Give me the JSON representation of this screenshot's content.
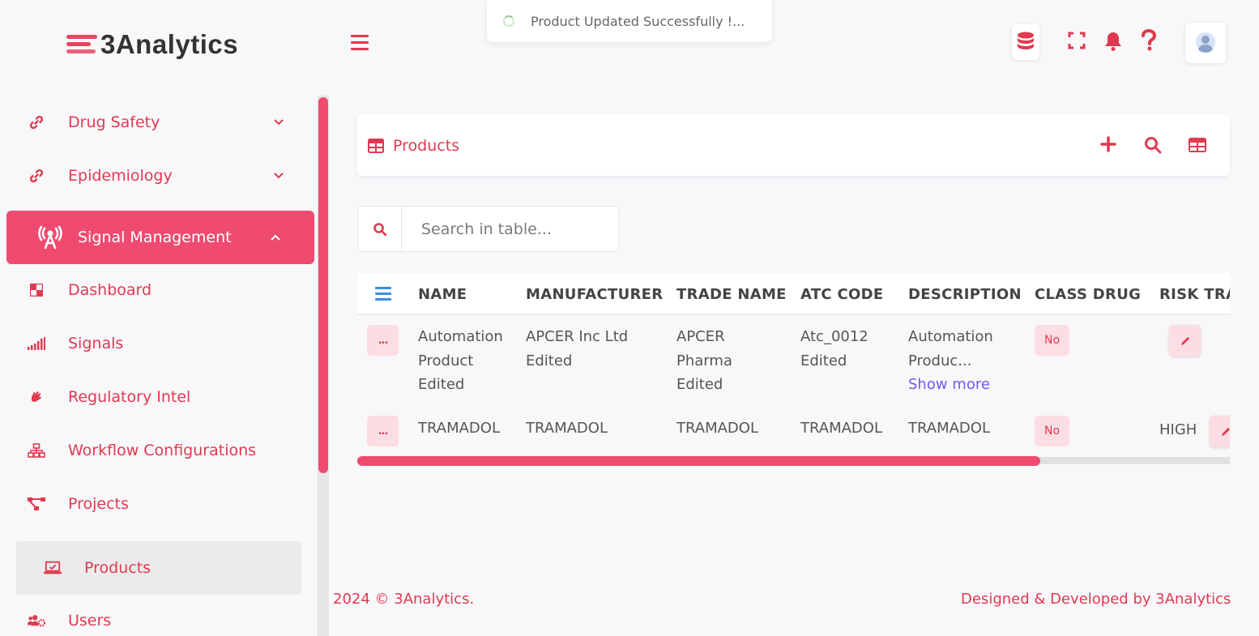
{
  "brand": {
    "name": "3Analytics",
    "accent": "#ef4b70",
    "primary_text": "#e03a4f"
  },
  "toast": {
    "message": "Product Updated Successfully !..."
  },
  "topbar": {
    "icons": [
      "database-icon",
      "fullscreen-icon",
      "bell-icon",
      "help-icon",
      "user-avatar-icon"
    ]
  },
  "sidebar": {
    "items": [
      {
        "label": "Drug Safety",
        "icon": "link-icon",
        "expandable": true
      },
      {
        "label": "Epidemiology",
        "icon": "link-icon",
        "expandable": true
      },
      {
        "label": "Signal Management",
        "icon": "antenna-icon",
        "expanded": true
      },
      {
        "label": "Dashboard",
        "icon": "dashboard-icon"
      },
      {
        "label": "Signals",
        "icon": "signal-bars-icon"
      },
      {
        "label": "Regulatory Intel",
        "icon": "hand-icon"
      },
      {
        "label": "Workflow Configurations",
        "icon": "sitemap-icon"
      },
      {
        "label": "Projects",
        "icon": "project-diagram-icon"
      },
      {
        "label": "Products",
        "icon": "laptop-icon",
        "selected": true
      },
      {
        "label": "Users",
        "icon": "users-cog-icon"
      }
    ]
  },
  "card": {
    "title": "Products"
  },
  "search": {
    "placeholder": "Search in table..."
  },
  "table": {
    "columns": [
      "NAME",
      "MANUFACTURER",
      "TRADE NAME",
      "ATC CODE",
      "DESCRIPTION",
      "CLASS DRUG",
      "RISK TRA"
    ],
    "rows": [
      {
        "name": [
          "Automation",
          "Product",
          "Edited"
        ],
        "manufacturer": [
          "APCER Inc Ltd",
          "Edited"
        ],
        "trade_name": [
          "APCER",
          "Pharma",
          "Edited"
        ],
        "atc_code": [
          "Atc_0012",
          "Edited"
        ],
        "description": [
          "Automation",
          "Produc..."
        ],
        "show_more": "Show more",
        "class_drug": "No",
        "risk": ""
      },
      {
        "name": [
          "TRAMADOL"
        ],
        "manufacturer": [
          "TRAMADOL"
        ],
        "trade_name": [
          "TRAMADOL"
        ],
        "atc_code": [
          "TRAMADOL"
        ],
        "description": [
          "TRAMADOL"
        ],
        "class_drug": "No",
        "risk": "HIGH"
      }
    ],
    "row_action_label": "..."
  },
  "footer": {
    "left": "2024 © 3Analytics.",
    "right": "Designed & Developed by 3Analytics"
  }
}
